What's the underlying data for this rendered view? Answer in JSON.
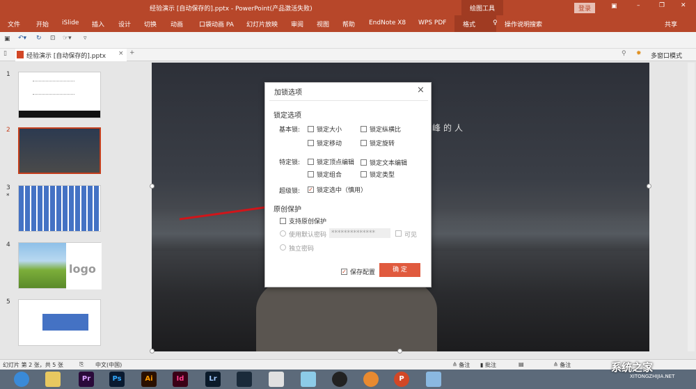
{
  "window": {
    "title": "经验演示 [自动保存的].pptx  -  PowerPoint(产品激活失败)",
    "context_tab": "绘图工具",
    "login": "登录",
    "share": "共享"
  },
  "ribbon_tabs": [
    "文件",
    "开始",
    "iSlide",
    "插入",
    "设计",
    "切换",
    "动画",
    "口袋动画 PA",
    "幻灯片放映",
    "审阅",
    "视图",
    "帮助",
    "EndNote X8",
    "WPS PDF",
    "格式"
  ],
  "search": "操作说明搜索",
  "doc_tab": {
    "name": "经验演示 [自动保存的].pptx",
    "multiwindow": "多窗口模式"
  },
  "thumbnails": [
    {
      "num": "1"
    },
    {
      "num": "2"
    },
    {
      "num": "3",
      "star": "*"
    },
    {
      "num": "4",
      "logo": "logo"
    },
    {
      "num": "5"
    }
  ],
  "slide": {
    "text": "峰的人"
  },
  "dialog": {
    "title": "加锁选项",
    "section1": "锁定选项",
    "groups": [
      {
        "label": "基本锁:",
        "items": [
          {
            "text": "锁定大小",
            "checked": false
          },
          {
            "text": "锁定纵横比",
            "checked": false
          },
          {
            "text": "锁定移动",
            "checked": false
          },
          {
            "text": "锁定旋转",
            "checked": false
          }
        ]
      },
      {
        "label": "特定锁:",
        "items": [
          {
            "text": "锁定顶点编辑",
            "checked": false
          },
          {
            "text": "锁定文本编辑",
            "checked": false
          },
          {
            "text": "锁定组合",
            "checked": false
          },
          {
            "text": "锁定类型",
            "checked": false
          }
        ]
      },
      {
        "label": "超级锁:",
        "items": [
          {
            "text": "锁定选中（慎用）",
            "checked": true
          }
        ]
      }
    ],
    "section2": "原创保护",
    "support": "支持原创保护",
    "default_pwd": "使用默认密码",
    "pwd_value": "**************",
    "visible": "可见",
    "own_pwd": "独立密码",
    "save_config": "保存配置",
    "ok": "确 定"
  },
  "status": {
    "slide_info": "幻灯片 第 2 张，共 5 张",
    "lang": "中文(中国)",
    "notes": "备注",
    "comments": "批注",
    "notes2": "备注"
  },
  "taskbar": [
    "Pr",
    "Ps",
    "Ai",
    "Id",
    "Lr"
  ],
  "watermark": {
    "text": "系统之家",
    "url": "XITONGZHIJIA.NET"
  }
}
